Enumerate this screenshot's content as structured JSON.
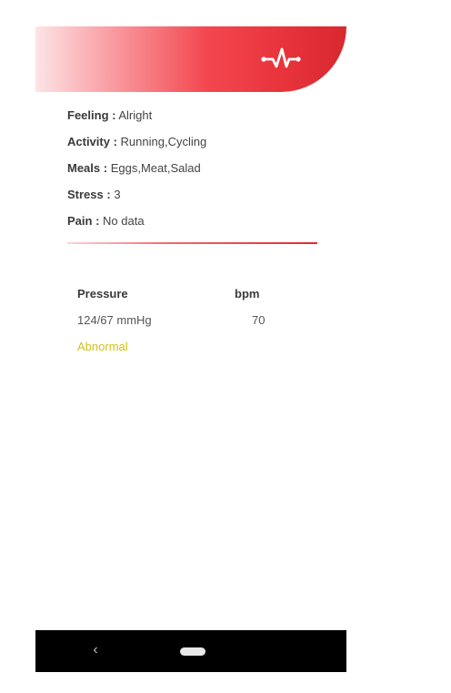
{
  "header": {
    "icon": "heartbeat-icon"
  },
  "info": {
    "feeling_label": "Feeling :",
    "feeling_value": "Alright",
    "activity_label": "Activity :",
    "activity_value": "Running,Cycling",
    "meals_label": "Meals :",
    "meals_value": "Eggs,Meat,Salad",
    "stress_label": "Stress :",
    "stress_value": "3",
    "pain_label": "Pain :",
    "pain_value": "No data"
  },
  "stats": {
    "pressure_header": "Pressure",
    "bpm_header": "bpm",
    "pressure_value": "124/67 mmHg",
    "bpm_value": "70",
    "status": "Abnormal"
  },
  "navbar": {
    "back_glyph": "‹"
  },
  "colors": {
    "accent": "#e8333b",
    "status_abnormal": "#cdc21a"
  }
}
